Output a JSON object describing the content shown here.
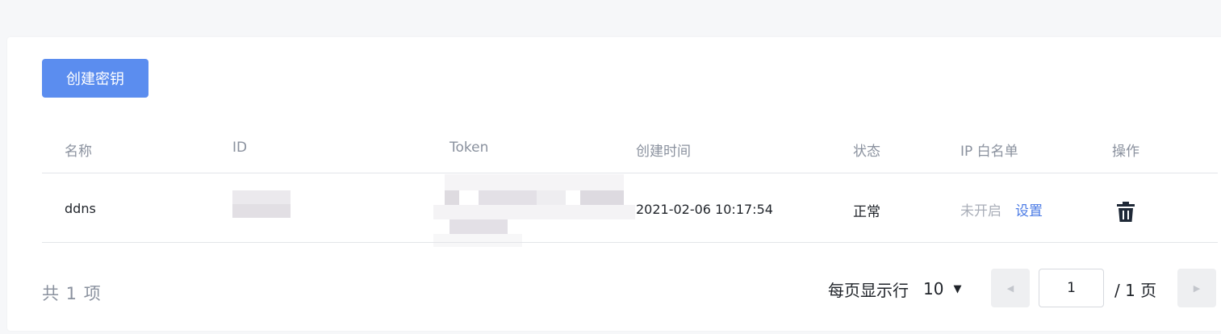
{
  "toolbar": {
    "create_label": "创建密钥"
  },
  "table": {
    "columns": [
      "名称",
      "ID",
      "Token",
      "创建时间",
      "状态",
      "IP 白名单",
      "操作"
    ],
    "rows": [
      {
        "name": "ddns",
        "created": "2021-02-06 10:17:54",
        "status": "正常",
        "ip_whitelist_status": "未开启",
        "ip_whitelist_action": "设置",
        "action_icon": "trash-icon"
      }
    ]
  },
  "pagination": {
    "total": "共 1 项",
    "per_page_label": "每页显示行",
    "per_page_value": "10",
    "current_page": "1",
    "total_pages": "/ 1 页"
  },
  "colors": {
    "primary": "#5b8def",
    "link": "#4b7be5",
    "muted": "#a9aeb8"
  }
}
